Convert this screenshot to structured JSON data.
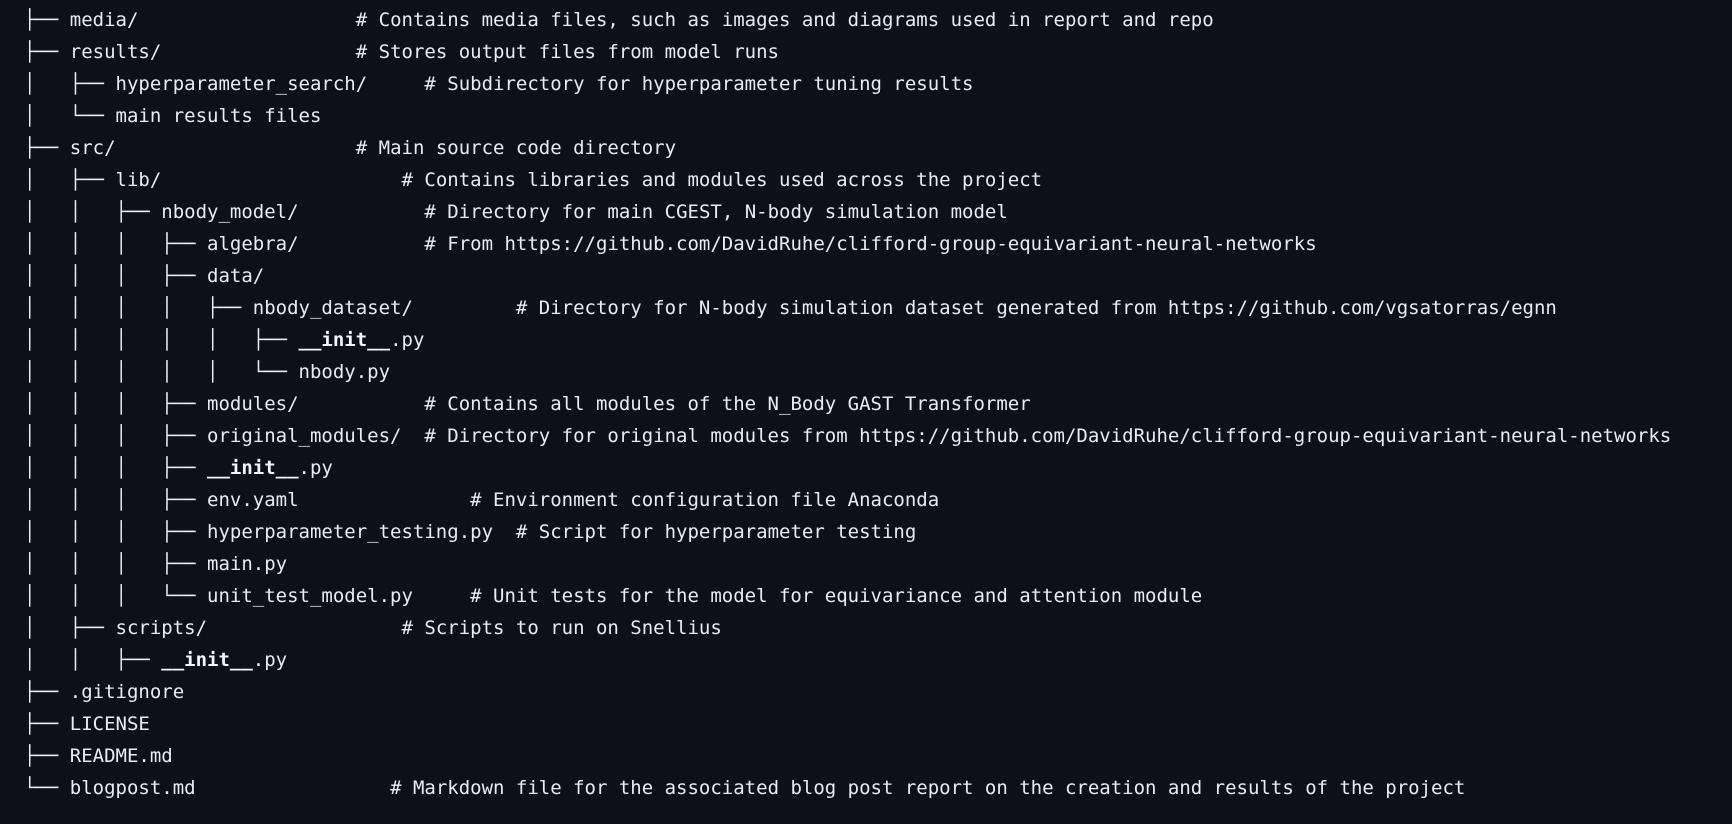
{
  "tree": {
    "lines": [
      {
        "prefix": "├── ",
        "name": "media/",
        "pad": "                   ",
        "comment": "# Contains media files, such as images and diagrams used in report and repo",
        "bold": false
      },
      {
        "prefix": "├── ",
        "name": "results/",
        "pad": "                 ",
        "comment": "# Stores output files from model runs",
        "bold": false
      },
      {
        "prefix": "│   ├── ",
        "name": "hyperparameter_search/",
        "pad": "     ",
        "comment": "# Subdirectory for hyperparameter tuning results",
        "bold": false
      },
      {
        "prefix": "│   └── ",
        "name": "main results files",
        "pad": "",
        "comment": "",
        "bold": false
      },
      {
        "prefix": "├── ",
        "name": "src/",
        "pad": "                     ",
        "comment": "# Main source code directory",
        "bold": false
      },
      {
        "prefix": "│   ├── ",
        "name": "lib/",
        "pad": "                     ",
        "comment": "# Contains libraries and modules used across the project",
        "bold": false
      },
      {
        "prefix": "│   │   ├── ",
        "name": "nbody_model/",
        "pad": "           ",
        "comment": "# Directory for main CGEST, N-body simulation model",
        "bold": false
      },
      {
        "prefix": "│   │   │   ├── ",
        "name": "algebra/",
        "pad": "           ",
        "comment": "# From https://github.com/DavidRuhe/clifford-group-equivariant-neural-networks",
        "bold": false
      },
      {
        "prefix": "│   │   │   ├── ",
        "name": "data/",
        "pad": "",
        "comment": "",
        "bold": false
      },
      {
        "prefix": "│   │   │   │   ├── ",
        "name": "nbody_dataset/",
        "pad": "         ",
        "comment": "# Directory for N-body simulation dataset generated from https://github.com/vgsatorras/egnn",
        "bold": false
      },
      {
        "prefix": "│   │   │   │   │   ├── ",
        "name": "__init__",
        "suffix": ".py",
        "pad": "",
        "comment": "",
        "bold": true
      },
      {
        "prefix": "│   │   │   │   │   └── ",
        "name": "nbody.py",
        "pad": "",
        "comment": "",
        "bold": false
      },
      {
        "prefix": "│   │   │   ├── ",
        "name": "modules/",
        "pad": "           ",
        "comment": "# Contains all modules of the N_Body GAST Transformer",
        "bold": false
      },
      {
        "prefix": "│   │   │   ├── ",
        "name": "original_modules/",
        "pad": "  ",
        "comment": "# Directory for original modules from https://github.com/DavidRuhe/clifford-group-equivariant-neural-networks",
        "bold": false
      },
      {
        "prefix": "│   │   │   ├── ",
        "name": "__init__",
        "suffix": ".py",
        "pad": "",
        "comment": "",
        "bold": true
      },
      {
        "prefix": "│   │   │   ├── ",
        "name": "env.yaml",
        "pad": "               ",
        "comment": "# Environment configuration file Anaconda",
        "bold": false
      },
      {
        "prefix": "│   │   │   ├── ",
        "name": "hyperparameter_testing.py",
        "pad": "  ",
        "comment": "# Script for hyperparameter testing",
        "bold": false
      },
      {
        "prefix": "│   │   │   ├── ",
        "name": "main.py",
        "pad": "",
        "comment": "",
        "bold": false
      },
      {
        "prefix": "│   │   │   └── ",
        "name": "unit_test_model.py",
        "pad": "     ",
        "comment": "# Unit tests for the model for equivariance and attention module",
        "bold": false
      },
      {
        "prefix": "│   ├── ",
        "name": "scripts/",
        "pad": "                 ",
        "comment": "# Scripts to run on Snellius",
        "bold": false
      },
      {
        "prefix": "│   │   ├── ",
        "name": "__init__",
        "suffix": ".py",
        "pad": "",
        "comment": "",
        "bold": true
      },
      {
        "prefix": "├── ",
        "name": ".gitignore",
        "pad": "",
        "comment": "",
        "bold": false
      },
      {
        "prefix": "├── ",
        "name": "LICENSE",
        "pad": "",
        "comment": "",
        "bold": false
      },
      {
        "prefix": "├── ",
        "name": "README.md",
        "pad": "",
        "comment": "",
        "bold": false
      },
      {
        "prefix": "└── ",
        "name": "blogpost.md",
        "pad": "                 ",
        "comment": "# Markdown file for the associated blog post report on the creation and results of the project",
        "bold": false
      }
    ]
  }
}
